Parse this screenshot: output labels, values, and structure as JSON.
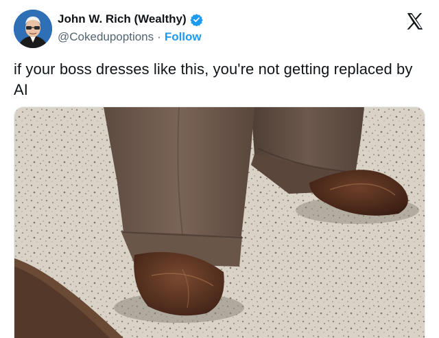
{
  "author": {
    "display_name": "John W. Rich (Wealthy)",
    "handle": "@Cokedupoptions",
    "separator": "·",
    "follow_label": "Follow",
    "verified": true
  },
  "platform": {
    "logo_icon": "x-logo-icon"
  },
  "tweet": {
    "text": "if your boss dresses like this, you're not getting replaced by AI"
  },
  "media": {
    "type": "photo"
  },
  "colors": {
    "accent": "#1d9bf0",
    "text_primary": "#0f1419",
    "text_secondary": "#536471",
    "trousers": "#6b5548",
    "shoes": "#4a2718",
    "floor": "#d8d0c4"
  }
}
